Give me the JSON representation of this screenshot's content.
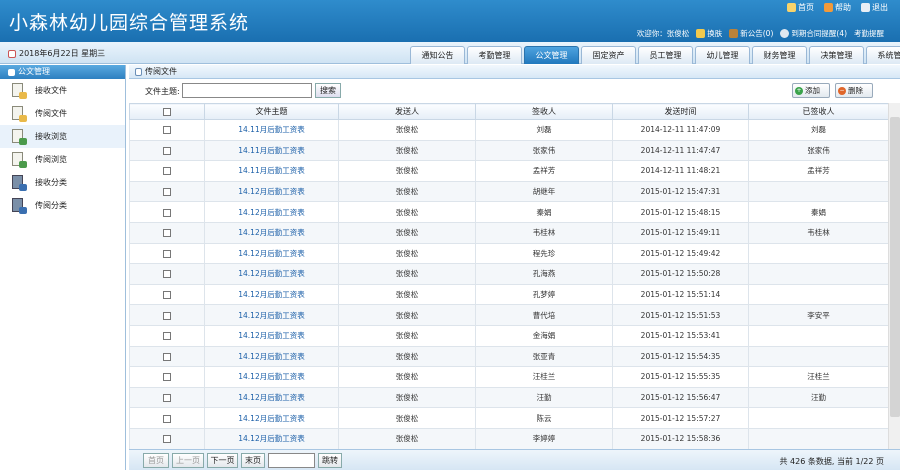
{
  "header": {
    "title": "小森林幼儿园综合管理系统",
    "top_links": [
      {
        "label": "首页",
        "icon": "home-icon"
      },
      {
        "label": "帮助",
        "icon": "help-icon"
      },
      {
        "label": "退出",
        "icon": "exit-icon"
      }
    ],
    "welcome": "欢迎你：张俊松",
    "user_links": [
      {
        "label": "换肤",
        "icon": "skin-icon"
      },
      {
        "label": "新公告(0)",
        "icon": "notice-icon"
      },
      {
        "label": "到期合同提醒(4)",
        "icon": "contract-icon"
      },
      {
        "label": "考勤提醒",
        "icon": "attendance-icon"
      }
    ]
  },
  "nav": {
    "date": "2018年6月22日 星期三",
    "tabs": [
      "通知公告",
      "考勤管理",
      "公文管理",
      "固定资产",
      "员工管理",
      "幼儿管理",
      "财务管理",
      "决策管理",
      "系统管理"
    ],
    "active_tab": "公文管理"
  },
  "sidebar": {
    "title": "公文管理",
    "items": [
      "接收文件",
      "传阅文件",
      "接收浏览",
      "传阅浏览",
      "接收分类",
      "传阅分类"
    ],
    "selected": "接收浏览"
  },
  "main": {
    "panel_title": "传阅文件",
    "search_label": "文件主题:",
    "search_value": "",
    "search_button": "搜索",
    "add_button": "添加",
    "delete_button": "删除"
  },
  "table": {
    "columns": [
      "",
      "文件主题",
      "发送人",
      "签收人",
      "发送时间",
      "已签收人"
    ],
    "rows": [
      {
        "subject": "14.11月后勤工资表",
        "sender": "张俊松",
        "receiver": "刘磊",
        "time": "2014-12-11 11:47:09",
        "signed": "刘磊"
      },
      {
        "subject": "14.11月后勤工资表",
        "sender": "张俊松",
        "receiver": "张家伟",
        "time": "2014-12-11 11:47:47",
        "signed": "张家伟"
      },
      {
        "subject": "14.11月后勤工资表",
        "sender": "张俊松",
        "receiver": "孟祥芳",
        "time": "2014-12-11 11:48:21",
        "signed": "孟祥芳"
      },
      {
        "subject": "14.12月后勤工资表",
        "sender": "张俊松",
        "receiver": "胡继年",
        "time": "2015-01-12 15:47:31",
        "signed": ""
      },
      {
        "subject": "14.12月后勤工资表",
        "sender": "张俊松",
        "receiver": "秦娟",
        "time": "2015-01-12 15:48:15",
        "signed": "秦娟"
      },
      {
        "subject": "14.12月后勤工资表",
        "sender": "张俊松",
        "receiver": "韦桂林",
        "time": "2015-01-12 15:49:11",
        "signed": "韦桂林"
      },
      {
        "subject": "14.12月后勤工资表",
        "sender": "张俊松",
        "receiver": "程先珍",
        "time": "2015-01-12 15:49:42",
        "signed": ""
      },
      {
        "subject": "14.12月后勤工资表",
        "sender": "张俊松",
        "receiver": "孔海燕",
        "time": "2015-01-12 15:50:28",
        "signed": ""
      },
      {
        "subject": "14.12月后勤工资表",
        "sender": "张俊松",
        "receiver": "孔梦婷",
        "time": "2015-01-12 15:51:14",
        "signed": ""
      },
      {
        "subject": "14.12月后勤工资表",
        "sender": "张俊松",
        "receiver": "曹代培",
        "time": "2015-01-12 15:51:53",
        "signed": "李安平"
      },
      {
        "subject": "14.12月后勤工资表",
        "sender": "张俊松",
        "receiver": "金海娟",
        "time": "2015-01-12 15:53:41",
        "signed": ""
      },
      {
        "subject": "14.12月后勤工资表",
        "sender": "张俊松",
        "receiver": "张亚青",
        "time": "2015-01-12 15:54:35",
        "signed": ""
      },
      {
        "subject": "14.12月后勤工资表",
        "sender": "张俊松",
        "receiver": "汪桂兰",
        "time": "2015-01-12 15:55:35",
        "signed": "汪桂兰"
      },
      {
        "subject": "14.12月后勤工资表",
        "sender": "张俊松",
        "receiver": "汪勤",
        "time": "2015-01-12 15:56:47",
        "signed": "汪勤"
      },
      {
        "subject": "14.12月后勤工资表",
        "sender": "张俊松",
        "receiver": "陈云",
        "time": "2015-01-12 15:57:27",
        "signed": ""
      },
      {
        "subject": "14.12月后勤工资表",
        "sender": "张俊松",
        "receiver": "李婷婷",
        "time": "2015-01-12 15:58:36",
        "signed": ""
      }
    ]
  },
  "pager": {
    "first": "首页",
    "prev": "上一页",
    "next": "下一页",
    "last": "末页",
    "go": "跳转",
    "info": "共 426 条数据, 当前 1/22 页"
  }
}
